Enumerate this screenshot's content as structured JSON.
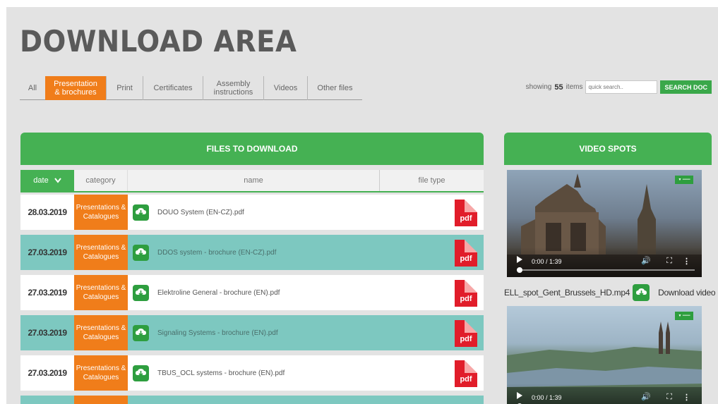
{
  "page": {
    "title": "DOWNLOAD AREA"
  },
  "tabs": [
    {
      "label": "All",
      "active": false
    },
    {
      "label": "Presentation\n& brochures",
      "active": true
    },
    {
      "label": "Print",
      "active": false
    },
    {
      "label": "Certificates",
      "active": false
    },
    {
      "label": "Assembly\ninstructions",
      "active": false
    },
    {
      "label": "Videos",
      "active": false
    },
    {
      "label": "Other files",
      "active": false
    }
  ],
  "search": {
    "showing_prefix": "showing",
    "count": "55",
    "showing_suffix": "items",
    "placeholder": "quick search..",
    "button_label": "SEARCH DOC"
  },
  "files": {
    "header": "FILES TO DOWNLOAD",
    "columns": {
      "date": "date",
      "category": "category",
      "name": "name",
      "file_type": "file type"
    },
    "rows": [
      {
        "date": "28.03.2019",
        "category": "Presentations & Catalogues",
        "name": "DOUO System (EN-CZ).pdf",
        "type": "pdf"
      },
      {
        "date": "27.03.2019",
        "category": "Presentations & Catalogues",
        "name": "DDOS system - brochure (EN-CZ).pdf",
        "type": "pdf"
      },
      {
        "date": "27.03.2019",
        "category": "Presentations & Catalogues",
        "name": "Elektroline General - brochure (EN).pdf",
        "type": "pdf"
      },
      {
        "date": "27.03.2019",
        "category": "Presentations & Catalogues",
        "name": "Signaling Systems - brochure (EN).pdf",
        "type": "pdf"
      },
      {
        "date": "27.03.2019",
        "category": "Presentations & Catalogues",
        "name": "TBUS_OCL systems - brochure (EN).pdf",
        "type": "pdf"
      }
    ]
  },
  "videos": {
    "header": "VIDEO SPOTS",
    "items": [
      {
        "time": "0:00 / 1:39",
        "filename": "ELL_spot_Gent_Brussels_HD.mp4",
        "download_label": "Download video"
      },
      {
        "time": "0:00 / 1:39"
      }
    ]
  },
  "colors": {
    "green": "#45b153",
    "orange": "#f07d1a",
    "teal": "#7dc8c0",
    "pdf_red": "#e11d2a"
  }
}
